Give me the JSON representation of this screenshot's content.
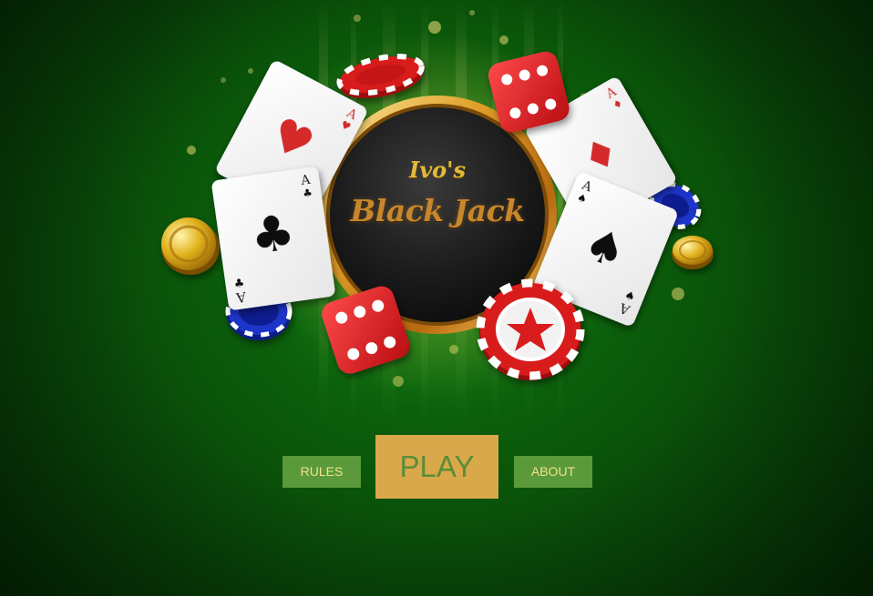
{
  "logo": {
    "line1": "Ivo's",
    "line2": "Black Jack"
  },
  "cards": [
    {
      "rank": "A",
      "suit": "hearts",
      "symbol": "♥",
      "color": "#d42a2a"
    },
    {
      "rank": "A",
      "suit": "clubs",
      "symbol": "♣",
      "color": "#111111"
    },
    {
      "rank": "A",
      "suit": "diamonds",
      "symbol": "♦",
      "color": "#d42a2a"
    },
    {
      "rank": "A",
      "suit": "spades",
      "symbol": "♠",
      "color": "#111111"
    }
  ],
  "menu": {
    "rules_label": "RULES",
    "play_label": "PLAY",
    "about_label": "ABOUT"
  },
  "colors": {
    "background": "#0a5a0a",
    "button_small": "#5b9a3a",
    "button_small_text": "#f2e28a",
    "button_play": "#d9a84a",
    "button_play_text": "#5a8e37",
    "logo_gold": "#e3b93a",
    "logo_bronze": "#c8862d"
  }
}
